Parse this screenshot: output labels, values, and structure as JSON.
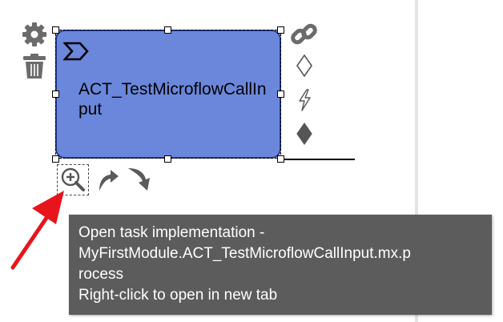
{
  "task": {
    "label": "ACT_TestMicroflowCallInput",
    "fill_color": "#6a87db",
    "border_color": "#223a8a"
  },
  "context_pad": {
    "left_icons": [
      "gear-icon",
      "trash-icon"
    ],
    "right_icons": [
      "link-icon",
      "hollow-diamond-icon",
      "lightning-icon",
      "filled-diamond-icon"
    ],
    "bottom_icons": [
      "zoom-in-icon",
      "curved-arrow-up-icon",
      "curved-arrow-down-icon"
    ]
  },
  "tooltip": {
    "line1": "Open task implementation -",
    "line2": "MyFirstModule.ACT_TestMicroflowCallInput.mx.p",
    "line3": "rocess",
    "line4": "Right-click to open in new tab"
  },
  "annotation": {
    "arrow_color": "#e8141c"
  }
}
